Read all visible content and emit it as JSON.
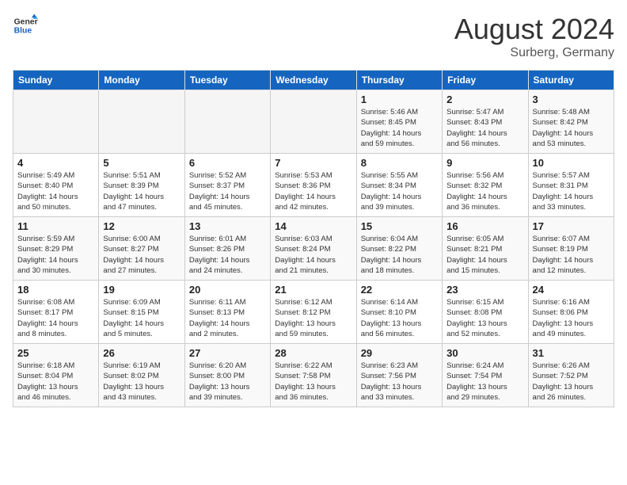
{
  "logo": {
    "line1": "General",
    "line2": "Blue"
  },
  "title": "August 2024",
  "subtitle": "Surberg, Germany",
  "days_of_week": [
    "Sunday",
    "Monday",
    "Tuesday",
    "Wednesday",
    "Thursday",
    "Friday",
    "Saturday"
  ],
  "weeks": [
    [
      {
        "day": "",
        "info": ""
      },
      {
        "day": "",
        "info": ""
      },
      {
        "day": "",
        "info": ""
      },
      {
        "day": "",
        "info": ""
      },
      {
        "day": "1",
        "info": "Sunrise: 5:46 AM\nSunset: 8:45 PM\nDaylight: 14 hours\nand 59 minutes."
      },
      {
        "day": "2",
        "info": "Sunrise: 5:47 AM\nSunset: 8:43 PM\nDaylight: 14 hours\nand 56 minutes."
      },
      {
        "day": "3",
        "info": "Sunrise: 5:48 AM\nSunset: 8:42 PM\nDaylight: 14 hours\nand 53 minutes."
      }
    ],
    [
      {
        "day": "4",
        "info": "Sunrise: 5:49 AM\nSunset: 8:40 PM\nDaylight: 14 hours\nand 50 minutes."
      },
      {
        "day": "5",
        "info": "Sunrise: 5:51 AM\nSunset: 8:39 PM\nDaylight: 14 hours\nand 47 minutes."
      },
      {
        "day": "6",
        "info": "Sunrise: 5:52 AM\nSunset: 8:37 PM\nDaylight: 14 hours\nand 45 minutes."
      },
      {
        "day": "7",
        "info": "Sunrise: 5:53 AM\nSunset: 8:36 PM\nDaylight: 14 hours\nand 42 minutes."
      },
      {
        "day": "8",
        "info": "Sunrise: 5:55 AM\nSunset: 8:34 PM\nDaylight: 14 hours\nand 39 minutes."
      },
      {
        "day": "9",
        "info": "Sunrise: 5:56 AM\nSunset: 8:32 PM\nDaylight: 14 hours\nand 36 minutes."
      },
      {
        "day": "10",
        "info": "Sunrise: 5:57 AM\nSunset: 8:31 PM\nDaylight: 14 hours\nand 33 minutes."
      }
    ],
    [
      {
        "day": "11",
        "info": "Sunrise: 5:59 AM\nSunset: 8:29 PM\nDaylight: 14 hours\nand 30 minutes."
      },
      {
        "day": "12",
        "info": "Sunrise: 6:00 AM\nSunset: 8:27 PM\nDaylight: 14 hours\nand 27 minutes."
      },
      {
        "day": "13",
        "info": "Sunrise: 6:01 AM\nSunset: 8:26 PM\nDaylight: 14 hours\nand 24 minutes."
      },
      {
        "day": "14",
        "info": "Sunrise: 6:03 AM\nSunset: 8:24 PM\nDaylight: 14 hours\nand 21 minutes."
      },
      {
        "day": "15",
        "info": "Sunrise: 6:04 AM\nSunset: 8:22 PM\nDaylight: 14 hours\nand 18 minutes."
      },
      {
        "day": "16",
        "info": "Sunrise: 6:05 AM\nSunset: 8:21 PM\nDaylight: 14 hours\nand 15 minutes."
      },
      {
        "day": "17",
        "info": "Sunrise: 6:07 AM\nSunset: 8:19 PM\nDaylight: 14 hours\nand 12 minutes."
      }
    ],
    [
      {
        "day": "18",
        "info": "Sunrise: 6:08 AM\nSunset: 8:17 PM\nDaylight: 14 hours\nand 8 minutes."
      },
      {
        "day": "19",
        "info": "Sunrise: 6:09 AM\nSunset: 8:15 PM\nDaylight: 14 hours\nand 5 minutes."
      },
      {
        "day": "20",
        "info": "Sunrise: 6:11 AM\nSunset: 8:13 PM\nDaylight: 14 hours\nand 2 minutes."
      },
      {
        "day": "21",
        "info": "Sunrise: 6:12 AM\nSunset: 8:12 PM\nDaylight: 13 hours\nand 59 minutes."
      },
      {
        "day": "22",
        "info": "Sunrise: 6:14 AM\nSunset: 8:10 PM\nDaylight: 13 hours\nand 56 minutes."
      },
      {
        "day": "23",
        "info": "Sunrise: 6:15 AM\nSunset: 8:08 PM\nDaylight: 13 hours\nand 52 minutes."
      },
      {
        "day": "24",
        "info": "Sunrise: 6:16 AM\nSunset: 8:06 PM\nDaylight: 13 hours\nand 49 minutes."
      }
    ],
    [
      {
        "day": "25",
        "info": "Sunrise: 6:18 AM\nSunset: 8:04 PM\nDaylight: 13 hours\nand 46 minutes."
      },
      {
        "day": "26",
        "info": "Sunrise: 6:19 AM\nSunset: 8:02 PM\nDaylight: 13 hours\nand 43 minutes."
      },
      {
        "day": "27",
        "info": "Sunrise: 6:20 AM\nSunset: 8:00 PM\nDaylight: 13 hours\nand 39 minutes."
      },
      {
        "day": "28",
        "info": "Sunrise: 6:22 AM\nSunset: 7:58 PM\nDaylight: 13 hours\nand 36 minutes."
      },
      {
        "day": "29",
        "info": "Sunrise: 6:23 AM\nSunset: 7:56 PM\nDaylight: 13 hours\nand 33 minutes."
      },
      {
        "day": "30",
        "info": "Sunrise: 6:24 AM\nSunset: 7:54 PM\nDaylight: 13 hours\nand 29 minutes."
      },
      {
        "day": "31",
        "info": "Sunrise: 6:26 AM\nSunset: 7:52 PM\nDaylight: 13 hours\nand 26 minutes."
      }
    ]
  ]
}
